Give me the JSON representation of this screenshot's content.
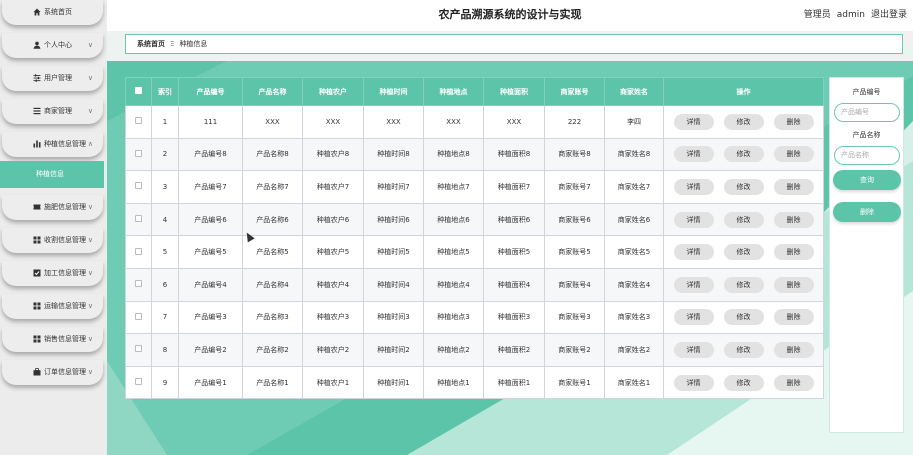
{
  "header": {
    "title": "农产品溯源系统的设计与实现",
    "user_role": "管理员",
    "user_name": "admin",
    "logout": "退出登录"
  },
  "sidebar": {
    "items": [
      {
        "label": "系统首页",
        "icon": "home-icon",
        "chevron": ""
      },
      {
        "label": "个人中心",
        "icon": "user-icon",
        "chevron": "∨"
      },
      {
        "label": "用户管理",
        "icon": "sliders-icon",
        "chevron": "∨"
      },
      {
        "label": "商家管理",
        "icon": "list-icon",
        "chevron": "∨"
      },
      {
        "label": "种植信息管理",
        "icon": "bar-chart-icon",
        "chevron": "∧"
      },
      {
        "label": "施肥信息管理",
        "icon": "ticket-icon",
        "chevron": "∨"
      },
      {
        "label": "收割信息管理",
        "icon": "grid-icon",
        "chevron": "∨"
      },
      {
        "label": "加工信息管理",
        "icon": "checkbox-icon",
        "chevron": "∨"
      },
      {
        "label": "运输信息管理",
        "icon": "grid-icon",
        "chevron": "∨"
      },
      {
        "label": "销售信息管理",
        "icon": "grid-icon",
        "chevron": "∨"
      },
      {
        "label": "订单信息管理",
        "icon": "briefcase-icon",
        "chevron": "∨"
      }
    ],
    "active_sub": "种植信息"
  },
  "breadcrumb": {
    "home": "系统首页",
    "sep": "Ξ",
    "current": "种植信息"
  },
  "table": {
    "columns": [
      "索引",
      "产品编号",
      "产品名称",
      "种植农户",
      "种植时间",
      "种植地点",
      "种植面积",
      "商家账号",
      "商家姓名",
      "操作"
    ],
    "actions": [
      "详情",
      "修改",
      "删除"
    ],
    "rows": [
      [
        "1",
        "111",
        "XXX",
        "XXX",
        "XXX",
        "XXX",
        "XXX",
        "222",
        "李四"
      ],
      [
        "2",
        "产品编号8",
        "产品名称8",
        "种植农户8",
        "种植时间8",
        "种植地点8",
        "种植面积8",
        "商家账号8",
        "商家姓名8"
      ],
      [
        "3",
        "产品编号7",
        "产品名称7",
        "种植农户7",
        "种植时间7",
        "种植地点7",
        "种植面积7",
        "商家账号7",
        "商家姓名7"
      ],
      [
        "4",
        "产品编号6",
        "产品名称6",
        "种植农户6",
        "种植时间6",
        "种植地点6",
        "种植面积6",
        "商家账号6",
        "商家姓名6"
      ],
      [
        "5",
        "产品编号5",
        "产品名称5",
        "种植农户5",
        "种植时间5",
        "种植地点5",
        "种植面积5",
        "商家账号5",
        "商家姓名5"
      ],
      [
        "6",
        "产品编号4",
        "产品名称4",
        "种植农户4",
        "种植时间4",
        "种植地点4",
        "种植面积4",
        "商家账号4",
        "商家姓名4"
      ],
      [
        "7",
        "产品编号3",
        "产品名称3",
        "种植农户3",
        "种植时间3",
        "种植地点3",
        "种植面积3",
        "商家账号3",
        "商家姓名3"
      ],
      [
        "8",
        "产品编号2",
        "产品名称2",
        "种植农户2",
        "种植时间2",
        "种植地点2",
        "种植面积2",
        "商家账号2",
        "商家姓名2"
      ],
      [
        "9",
        "产品编号1",
        "产品名称1",
        "种植农户1",
        "种植时间1",
        "种植地点1",
        "种植面积1",
        "商家账号1",
        "商家姓名1"
      ]
    ]
  },
  "search": {
    "label1": "产品编号",
    "placeholder1": "产品编号",
    "label2": "产品名称",
    "placeholder2": "产品名称",
    "query_btn": "查询",
    "delete_btn": "删除"
  },
  "colors": {
    "accent": "#5cc4a9",
    "sidebar_bg": "#ececec"
  }
}
